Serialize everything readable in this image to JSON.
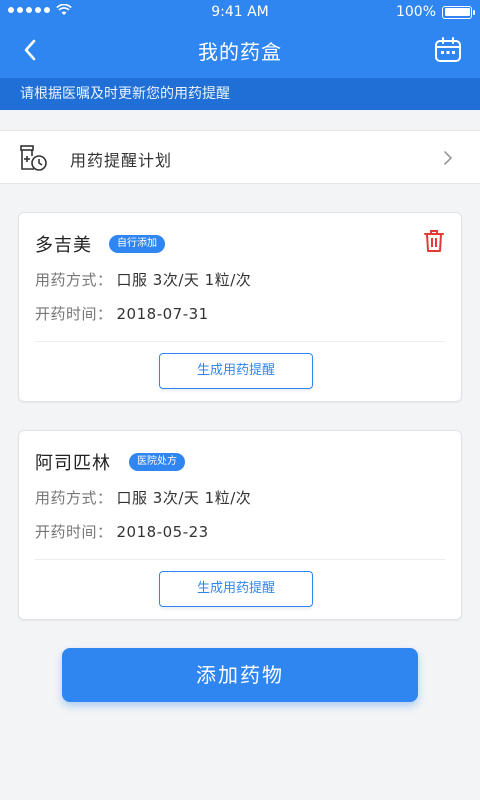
{
  "status_bar": {
    "time": "9:41 AM",
    "battery": "100%"
  },
  "header": {
    "title": "我的药盒"
  },
  "tip_bar": {
    "text": "请根据医嘱及时更新您的用药提醒"
  },
  "plan_row": {
    "label": "用药提醒计划"
  },
  "medicines": [
    {
      "name": "多吉美",
      "badge": "自行添加",
      "method_label": "用药方式：",
      "method_value": "口服 3次/天 1粒/次",
      "date_label": "开药时间：",
      "date_value": "2018-07-31",
      "button_label": "生成用药提醒"
    },
    {
      "name": "阿司匹林",
      "badge": "医院处方",
      "method_label": "用药方式：",
      "method_value": "口服 3次/天 1粒/次",
      "date_label": "开药时间：",
      "date_value": "2018-05-23",
      "button_label": "生成用药提醒"
    }
  ],
  "add_button": {
    "label": "添加药物"
  },
  "icons": {
    "back": "back-arrow-icon",
    "calendar": "calendar-icon",
    "plan": "medicine-clock-icon",
    "chevron": "chevron-right-icon",
    "trash": "trash-icon"
  },
  "colors": {
    "primary": "#2f86f0",
    "tip_bar": "#1f6fd6",
    "delete": "#e53935",
    "background": "#f3f4f6"
  }
}
